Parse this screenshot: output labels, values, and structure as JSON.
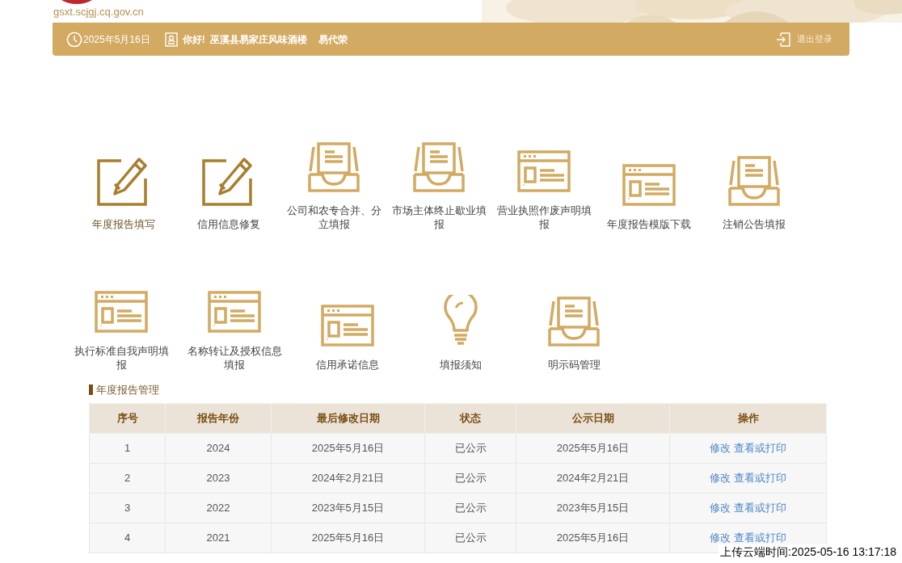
{
  "site": {
    "url": "gsxt.scjgj.cq.gov.cn"
  },
  "header": {
    "date": "2025年5月16日",
    "greeting": "你好!",
    "company": "巫溪县易家庄风味酒楼",
    "person": "易代荣",
    "logout": "退出登录"
  },
  "menu_rows": [
    [
      {
        "kind": "edit",
        "label": "年度报告填写"
      },
      {
        "kind": "edit",
        "label": "信用信息修复"
      },
      {
        "kind": "tray",
        "label": "公司和农专合并、分立填报"
      },
      {
        "kind": "tray",
        "label": "市场主体终止歇业填报"
      },
      {
        "kind": "form",
        "label": "营业执照作废声明填报"
      },
      {
        "kind": "form",
        "label": "年度报告模版下载"
      },
      {
        "kind": "tray",
        "label": "注销公告填报"
      }
    ],
    [
      {
        "kind": "form",
        "label": "执行标准自我声明填报"
      },
      {
        "kind": "form",
        "label": "名称转让及授权信息填报"
      },
      {
        "kind": "form",
        "label": "信用承诺信息"
      },
      {
        "kind": "bulb",
        "label": "填报须知"
      },
      {
        "kind": "tray",
        "label": "明示码管理"
      }
    ]
  ],
  "section_title": "年度报告管理",
  "table": {
    "columns": [
      "序号",
      "报告年份",
      "最后修改日期",
      "状态",
      "公示日期",
      "操作"
    ],
    "rows": [
      {
        "cells": [
          "1",
          "2024",
          "2025年5月16日",
          "已公示",
          "2025年5月16日"
        ],
        "actions": [
          "修改",
          "查看或打印"
        ]
      },
      {
        "cells": [
          "2",
          "2023",
          "2024年2月21日",
          "已公示",
          "2024年2月21日"
        ],
        "actions": [
          "修改",
          "查看或打印"
        ]
      },
      {
        "cells": [
          "3",
          "2022",
          "2023年5月15日",
          "已公示",
          "2023年5月15日"
        ],
        "actions": [
          "修改",
          "查看或打印"
        ]
      },
      {
        "cells": [
          "4",
          "2021",
          "2025年5月16日",
          "已公示",
          "2025年5月16日"
        ],
        "actions": [
          "修改",
          "查看或打印"
        ]
      }
    ]
  },
  "upload_time": "上传云端时间:2025-05-16 13:17:18"
}
